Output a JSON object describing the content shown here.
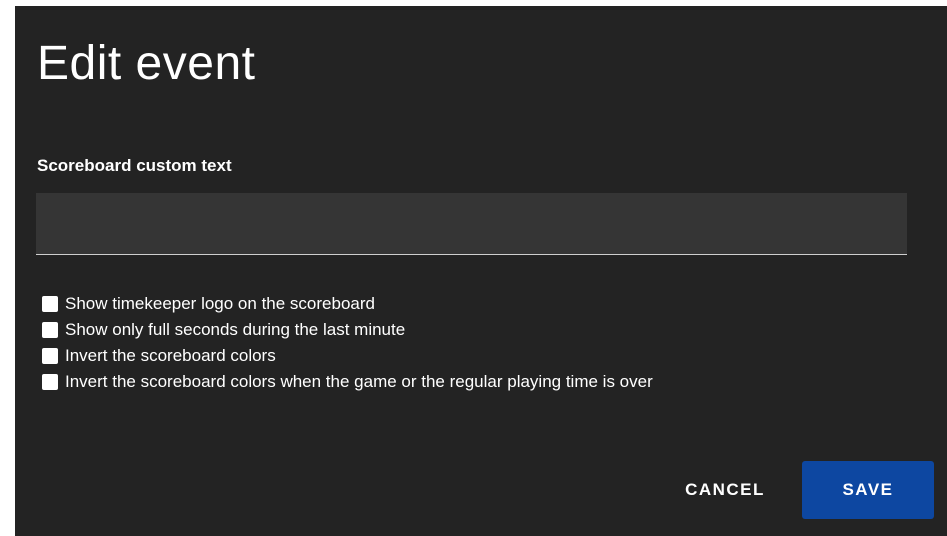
{
  "dialog": {
    "title": "Edit event",
    "field": {
      "label": "Scoreboard custom text",
      "value": "",
      "placeholder": ""
    },
    "options": [
      {
        "label": "Show timekeeper logo on the scoreboard",
        "checked": false
      },
      {
        "label": "Show only full seconds during the last minute",
        "checked": false
      },
      {
        "label": "Invert the scoreboard colors",
        "checked": false
      },
      {
        "label": "Invert the scoreboard colors when the game or the regular playing time is over",
        "checked": false
      }
    ],
    "buttons": {
      "cancel_label": "CANCEL",
      "save_label": "SAVE"
    }
  },
  "colors": {
    "background": "#232323",
    "input_background": "#353535",
    "accent": "#0d47a1",
    "text": "#ffffff"
  }
}
